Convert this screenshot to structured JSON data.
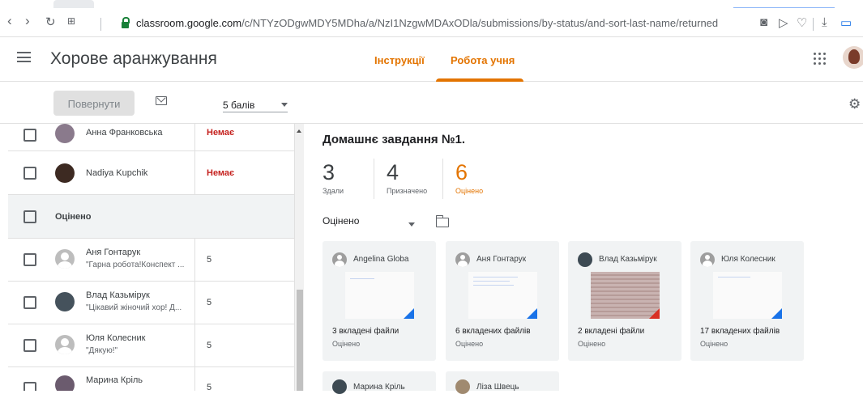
{
  "browser": {
    "url_host": "classroom.google.com",
    "url_path": "/c/NTYzODgwMDY5MDha/a/NzI1NzgwMDAxODla/submissions/by-status/and-sort-last-name/returned"
  },
  "header": {
    "class_name": "Хорове аранжування",
    "tabs": [
      {
        "label": "Інструкції"
      },
      {
        "label": "Робота учня"
      }
    ]
  },
  "toolbar": {
    "return_label": "Повернути",
    "points_value": "5 балів"
  },
  "students_top": [
    {
      "name": "Анна Франковська",
      "status": "Немає"
    },
    {
      "name": "Nadiya Kupchik",
      "status": "Немає"
    }
  ],
  "section": {
    "label": "Оцінено"
  },
  "students_graded": [
    {
      "name": "Аня Гонтарук",
      "comment": "\"Гарна робота!Конспект ...",
      "grade": "5"
    },
    {
      "name": "Влад Казьмірук",
      "comment": "\"Цікавий жіночий хор! Д...",
      "grade": "5"
    },
    {
      "name": "Юля Колесник",
      "comment": "\"Дякую!\"",
      "grade": "5"
    },
    {
      "name": "Марина Кріль",
      "comment": "",
      "grade": "5"
    }
  ],
  "assignment": {
    "title": "Домашнє завдання №1.",
    "stats": [
      {
        "num": "3",
        "label": "Здали"
      },
      {
        "num": "4",
        "label": "Призначено"
      },
      {
        "num": "6",
        "label": "Оцінено"
      }
    ],
    "filter": "Оцінено"
  },
  "cards": [
    {
      "name": "Angelina Globa",
      "files": "3 вкладені файли",
      "status": "Оцінено"
    },
    {
      "name": "Аня Гонтарук",
      "files": "6 вкладених файлів",
      "status": "Оцінено"
    },
    {
      "name": "Влад Казьмірук",
      "files": "2 вкладені файли",
      "status": "Оцінено"
    },
    {
      "name": "Юля Колесник",
      "files": "17 вкладених файлів",
      "status": "Оцінено"
    },
    {
      "name": "Марина Кріль"
    },
    {
      "name": "Ліза Швець"
    }
  ],
  "colors": {
    "accent": "#e37400",
    "missing": "#c5221f",
    "blue_corner": "#1a73e8"
  },
  "icons": [
    "back-icon",
    "forward-icon",
    "reload-icon",
    "apps-grid-icon",
    "lock-icon",
    "camera-icon",
    "send-icon",
    "heart-icon",
    "download-icon",
    "battery-icon",
    "menu-icon",
    "google-apps-icon",
    "mail-icon",
    "gear-icon",
    "folder-icon"
  ]
}
